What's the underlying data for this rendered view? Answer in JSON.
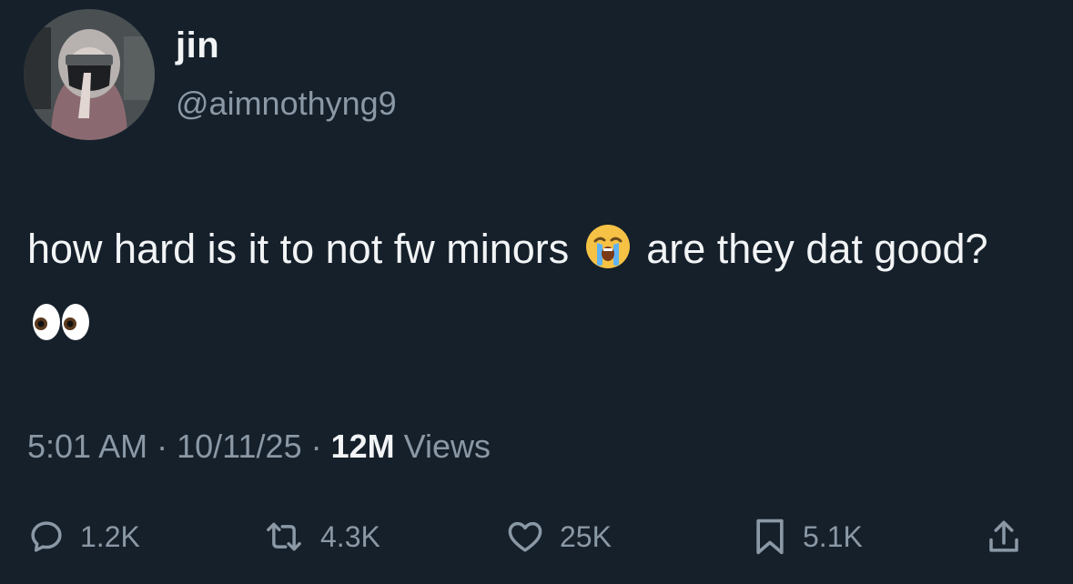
{
  "author": {
    "display_name": "jin",
    "handle": "@aimnothyng9"
  },
  "tweet": {
    "text_part1": "how hard is it to not fw minors ",
    "emoji1": "loudly-crying-face",
    "text_part2": " are they dat good? ",
    "emoji2": "eyes"
  },
  "meta": {
    "time": "5:01 AM",
    "separator": "·",
    "date": "10/11/25",
    "views_count": "12M",
    "views_label": "Views"
  },
  "actions": {
    "reply_count": "1.2K",
    "retweet_count": "4.3K",
    "like_count": "25K",
    "bookmark_count": "5.1K"
  },
  "colors": {
    "background": "#15202b",
    "text_primary": "#f2f4f5",
    "text_secondary": "#8b98a5"
  }
}
